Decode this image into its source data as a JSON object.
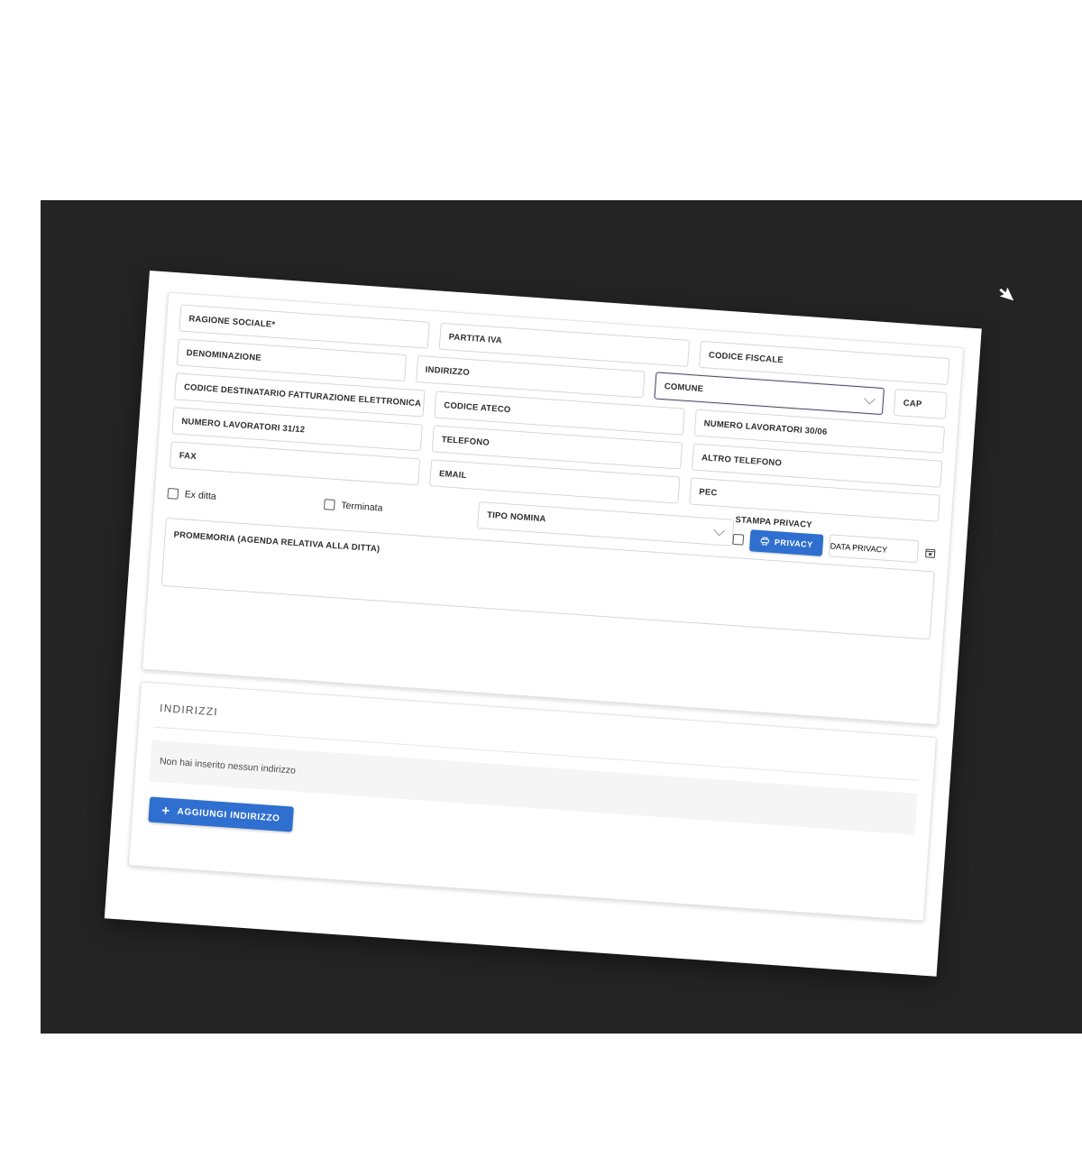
{
  "theme": {
    "accent": "#2f6fd0",
    "backdrop": "#242424",
    "page_bg": "#ffffff",
    "field_border": "#d6d6d6"
  },
  "form": {
    "rows": [
      {
        "fields": [
          {
            "label": "RAGIONE SOCIALE*",
            "name": "ragione-sociale",
            "type": "text"
          },
          {
            "label": "PARTITA IVA",
            "name": "partita-iva",
            "type": "text"
          },
          {
            "label": "CODICE FISCALE",
            "name": "codice-fiscale",
            "type": "text"
          }
        ]
      },
      {
        "fields": [
          {
            "label": "DENOMINAZIONE",
            "name": "denominazione",
            "type": "text"
          },
          {
            "label": "INDIRIZZO",
            "name": "indirizzo",
            "type": "text"
          },
          {
            "label": "COMUNE",
            "name": "comune",
            "type": "select",
            "focused": true
          },
          {
            "label": "CAP",
            "name": "cap",
            "type": "text"
          }
        ]
      },
      {
        "fields": [
          {
            "label": "CODICE DESTINATARIO FATTURAZIONE ELETTRONICA",
            "name": "codice-destinatario-fatturazione-elettronica",
            "type": "text"
          },
          {
            "label": "CODICE ATECO",
            "name": "codice-ateco",
            "type": "text"
          },
          {
            "label": "NUMERO LAVORATORI 30/06",
            "name": "numero-lavoratori-30-06",
            "type": "text"
          }
        ]
      },
      {
        "fields": [
          {
            "label": "NUMERO LAVORATORI 31/12",
            "name": "numero-lavoratori-31-12",
            "type": "text"
          },
          {
            "label": "TELEFONO",
            "name": "telefono",
            "type": "text"
          },
          {
            "label": "ALTRO TELEFONO",
            "name": "altro-telefono",
            "type": "text"
          }
        ]
      },
      {
        "fields": [
          {
            "label": "FAX",
            "name": "fax",
            "type": "text"
          },
          {
            "label": "EMAIL",
            "name": "email",
            "type": "text"
          },
          {
            "label": "PEC",
            "name": "pec",
            "type": "text"
          }
        ]
      }
    ],
    "checkbox_row": {
      "ex_ditta": {
        "label": "Ex ditta",
        "checked": false
      },
      "terminata": {
        "label": "Terminata",
        "checked": false
      },
      "tipo_nomina": {
        "label": "TIPO NOMINA",
        "type": "select"
      },
      "stampa_privacy_title": "STAMPA PRIVACY",
      "stampa_privacy_checked": false,
      "privacy_button": "PRIVACY",
      "privacy_button_icon": "printer-icon",
      "data_privacy": "DATA PRIVACY",
      "calendar_icon": "calendar-icon"
    },
    "promemoria": {
      "label": "PROMEMORIA (AGENDA RELATIVA ALLA DITTA)",
      "value": ""
    }
  },
  "indirizzi": {
    "title": "INDIRIZZI",
    "empty_message": "Non hai inserito nessun indirizzo",
    "add_button": "AGGIUNGI INDIRIZZO",
    "add_button_icon": "plus-icon"
  },
  "cursor": {
    "icon": "mouse-pointer-icon"
  }
}
